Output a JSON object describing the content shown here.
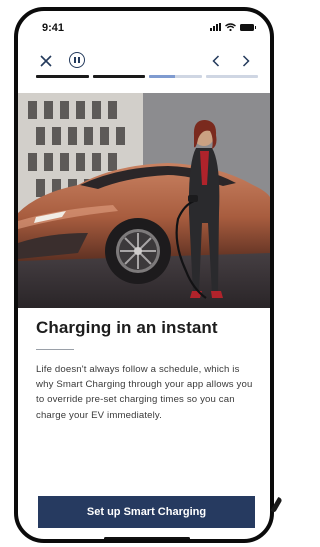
{
  "status_bar": {
    "time": "9:41"
  },
  "story": {
    "segments": [
      {
        "state": "done",
        "progress": 1.0
      },
      {
        "state": "done",
        "progress": 1.0
      },
      {
        "state": "active",
        "progress": 0.5
      },
      {
        "state": "pending",
        "progress": 0.0
      }
    ]
  },
  "card": {
    "title": "Charging in an instant",
    "body": "Life doesn't always follow a schedule, which is why Smart Charging through your app allows you to override pre-set charging times so you can charge your EV immediately."
  },
  "cta": {
    "label": "Set up Smart Charging"
  },
  "colors": {
    "accent": "#263a60",
    "progress_done": "#1a1a1a",
    "progress_active": "#7f9bd0",
    "progress_track": "#cfd6e3",
    "car_body": "#b86e4e"
  },
  "icons": {
    "close": "close-icon",
    "pause": "pause-icon",
    "prev": "chevron-left-icon",
    "next": "chevron-right-icon"
  }
}
